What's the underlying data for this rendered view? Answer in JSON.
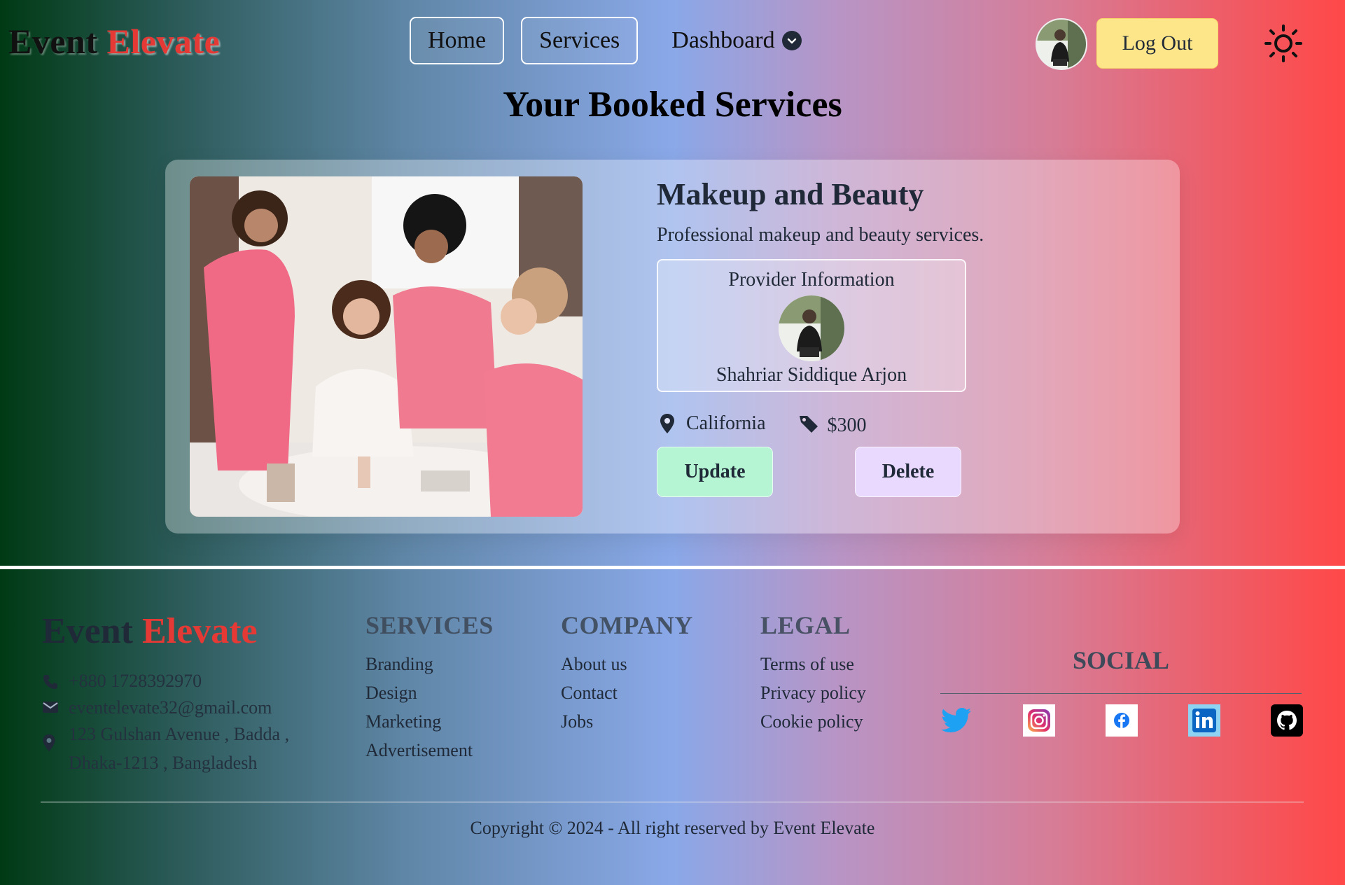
{
  "brand": {
    "word1": "Event",
    "word2": "Elevate"
  },
  "nav": {
    "home": "Home",
    "services": "Services",
    "dashboard": "Dashboard",
    "logout": "Log Out"
  },
  "page": {
    "title": "Your Booked Services"
  },
  "booking": {
    "service_name": "Makeup and Beauty",
    "description": "Professional makeup and beauty services.",
    "provider_heading": "Provider Information",
    "provider_name": "Shahriar Siddique Arjon",
    "location": "California",
    "price": "$300",
    "update_label": "Update",
    "delete_label": "Delete"
  },
  "footer": {
    "phone": "+880 1728392970",
    "email": "eventelevate32@gmail.com",
    "address_line1": "123 Gulshan Avenue , Badda ,",
    "address_line2": "Dhaka-1213 , Bangladesh",
    "services": {
      "title": "SERVICES",
      "links": [
        "Branding",
        "Design",
        "Marketing",
        "Advertisement"
      ]
    },
    "company": {
      "title": "COMPANY",
      "links": [
        "About us",
        "Contact",
        "Jobs"
      ]
    },
    "legal": {
      "title": "LEGAL",
      "links": [
        "Terms of use",
        "Privacy policy",
        "Cookie policy"
      ]
    },
    "social_title": "SOCIAL",
    "copyright": "Copyright © 2024 - All right reserved by Event Elevate"
  },
  "colors": {
    "brand_red": "#e53935",
    "logout_bg": "#fde68a",
    "update_bg": "#b5f5d3",
    "delete_bg": "#ead9ff"
  },
  "icons": [
    "chevron-down-icon",
    "sun-icon",
    "location-pin-icon",
    "price-tag-icon",
    "phone-icon",
    "mail-icon",
    "twitter-icon",
    "instagram-icon",
    "facebook-icon",
    "linkedin-icon",
    "github-icon"
  ]
}
